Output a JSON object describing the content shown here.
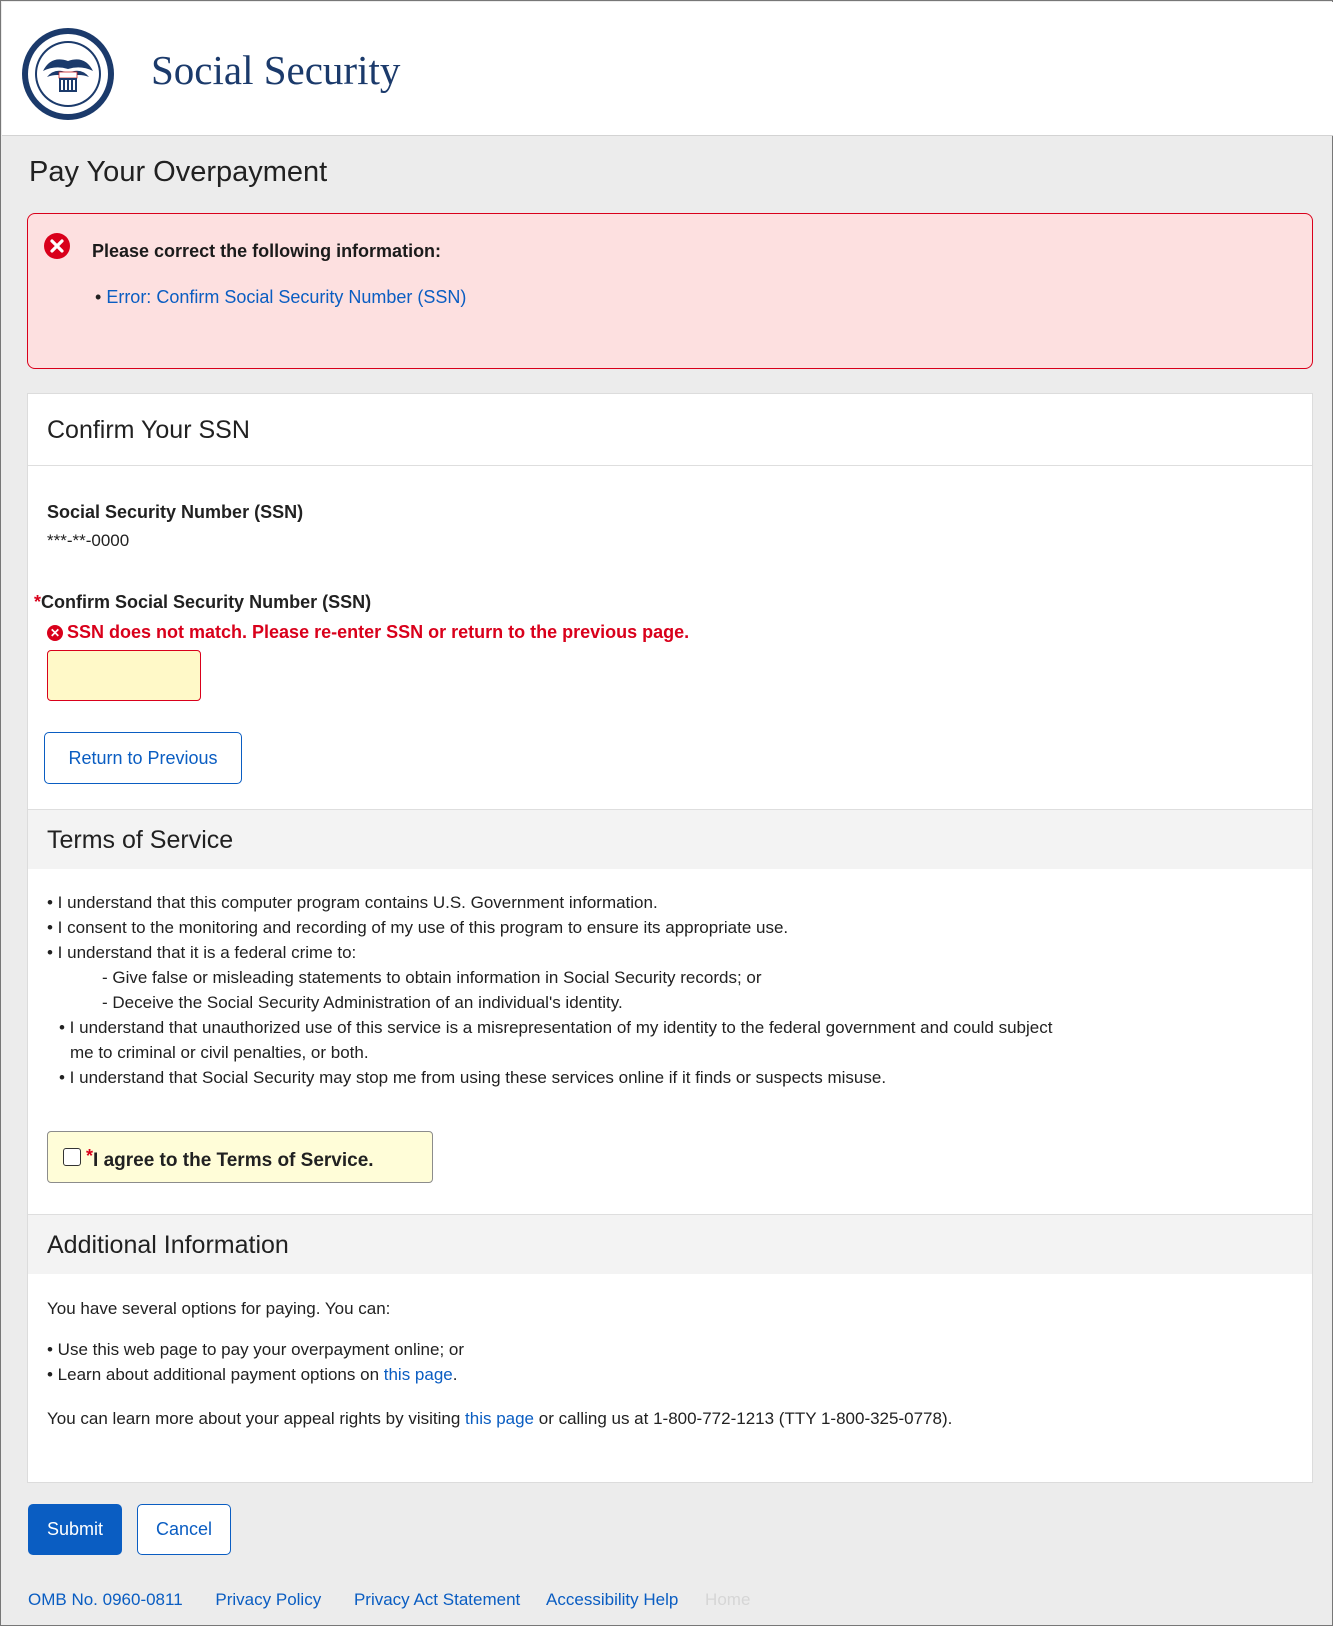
{
  "header": {
    "site_title": "Social Security"
  },
  "page": {
    "title": "Pay Your Overpayment"
  },
  "error_summary": {
    "heading": "Please correct the following information:",
    "link": "Error: Confirm Social Security Number (SSN)"
  },
  "confirm_section": {
    "heading": "Confirm Your SSN",
    "ssn_label": "Social Security Number (SSN)",
    "ssn_value": "***-**-0000",
    "required_marker": "*",
    "confirm_label": "Confirm Social Security Number (SSN)",
    "field_error": "SSN does not match. Please re-enter SSN or return to the previous page.",
    "confirm_value": "",
    "return_button": "Return to Previous"
  },
  "terms": {
    "heading": "Terms of Service",
    "lines": [
      "• I understand that this computer program contains U.S. Government information.",
      "• I consent to the monitoring and recording of my use of this program to ensure its appropriate use.",
      "• I understand that it is a federal crime to:",
      "- Give false or misleading statements to obtain information in Social Security records; or",
      "- Deceive the Social Security Administration of an individual's identity.",
      "• I understand that unauthorized use of this service is a misrepresentation of my identity to the federal government and could subject",
      "me to criminal or civil penalties, or both.",
      "• I understand that Social Security may stop me from using these services online if it finds or suspects misuse."
    ],
    "agree_label": "I agree to the Terms of Service."
  },
  "additional": {
    "heading": "Additional Information",
    "intro": "You have several options for paying.  You can:",
    "option1": "• Use this web page to pay your overpayment online; or",
    "option2_prefix": "• Learn about additional payment options on ",
    "option2_link": "this page",
    "option2_suffix": ".",
    "appeal_prefix": "You can learn more about your appeal rights by visiting ",
    "appeal_link": "this page",
    "appeal_suffix": " or calling us at 1-800-772-1213 (TTY 1-800-325-0778)."
  },
  "actions": {
    "submit": "Submit",
    "cancel": "Cancel"
  },
  "footer": {
    "omb": "OMB No. 0960-0811",
    "privacy_policy": "Privacy Policy",
    "privacy_act": "Privacy Act Statement",
    "accessibility": "Accessibility Help",
    "home": "Home"
  }
}
